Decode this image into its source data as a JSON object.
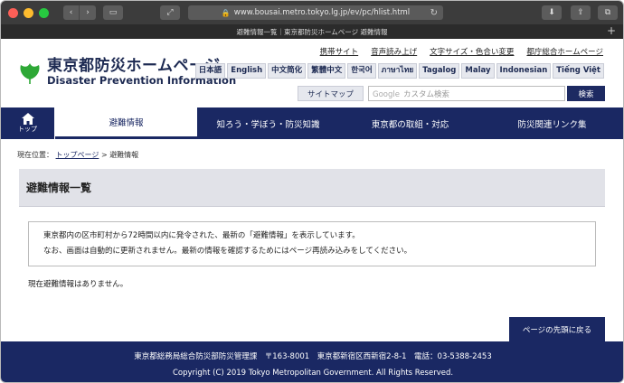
{
  "browser": {
    "url": "www.bousai.metro.tokyo.lg.jp/ev/pc/hlist.html",
    "tab_title": "避難情報一覧｜東京都防災ホームページ 避難情報"
  },
  "header": {
    "logo_jp": "東京都防災ホームページ",
    "logo_en": "Disaster Prevention Information",
    "util_links": [
      "携帯サイト",
      "音声読み上げ",
      "文字サイズ・色合い変更",
      "都庁総合ホームページ"
    ],
    "languages": [
      "日本語",
      "English",
      "中文简化",
      "繁體中文",
      "한국어",
      "ภาษาไทย",
      "Tagalog",
      "Malay",
      "Indonesian",
      "Tiếng Việt"
    ],
    "sitemap": "サイトマップ",
    "search_brand": "Google",
    "search_placeholder": "カスタム検索",
    "search_button": "検索"
  },
  "nav": {
    "home": "トップ",
    "items": [
      "避難情報",
      "知ろう・学ぼう・防災知識",
      "東京都の取組・対応",
      "防災関連リンク集"
    ]
  },
  "breadcrumb": {
    "prefix": "現在位置：",
    "top": "トップページ",
    "sep": ">",
    "current": "避難情報"
  },
  "main": {
    "title": "避難情報一覧",
    "notice_line1": "東京都内の区市町村から72時間以内に発令された、最新の「避難情報」を表示しています。",
    "notice_line2": "なお、画面は自動的に更新されません。最新の情報を確認するためにはページ再読み込みをしてください。",
    "no_info": "現在避難情報はありません。"
  },
  "totop": "ページの先頭に戻る",
  "footer": {
    "line1": "東京都総務局総合防災部防災管理課　〒163-8001　東京都新宿区西新宿2-8-1　電話：03-5388-2453",
    "line2": "Copyright (C) 2019 Tokyo Metropolitan Government. All Rights Reserved."
  },
  "colors": {
    "brand": "#1a2863",
    "logo_green": "#2ea836"
  },
  "icons": [
    "back-icon",
    "forward-icon",
    "sidebar-icon",
    "lock-icon",
    "reload-icon",
    "download-icon",
    "share-icon",
    "tabs-icon",
    "home-icon",
    "ginkgo-logo-icon"
  ]
}
